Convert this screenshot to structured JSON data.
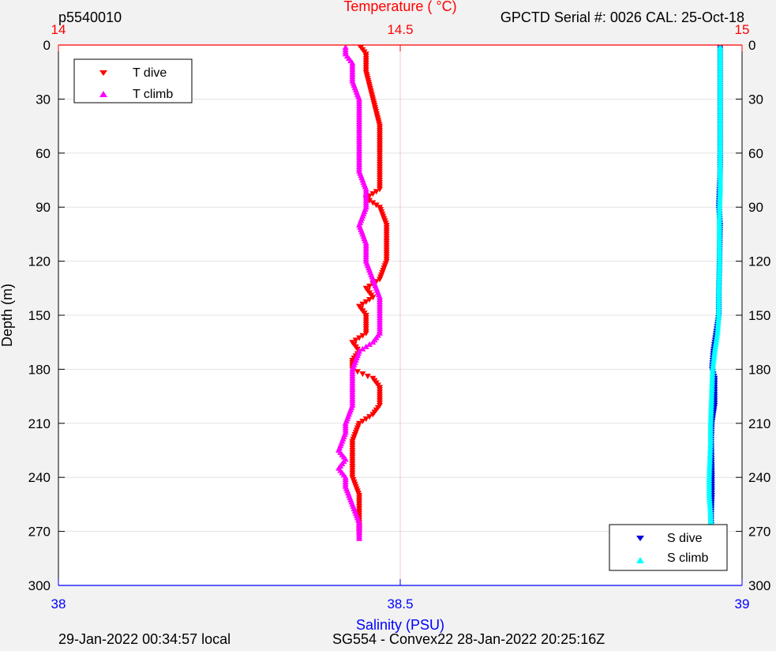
{
  "header": {
    "profile_id": "p5540010",
    "instrument_cal": "GPCTD Serial #: 0026 CAL: 25-Oct-18"
  },
  "footer": {
    "local_time": "29-Jan-2022 00:34:57 local",
    "mission": "SG554 - Convex22 28-Jan-2022 20:25:16Z"
  },
  "colors": {
    "background": "#f2f2f2",
    "plot_bg": "#ffffff",
    "temperature_axis": "#ff0000",
    "salinity_axis": "#0000ff",
    "t_dive": "#ff0000",
    "t_climb": "#ff00ff",
    "s_dive": "#0000dd",
    "s_climb": "#00ffff"
  },
  "chart_data": {
    "type": "scatter",
    "y_axis": {
      "label": "Depth (m)",
      "range": [
        0,
        300
      ],
      "reversed": true,
      "ticks": [
        "0",
        "30",
        "60",
        "90",
        "120",
        "150",
        "180",
        "210",
        "240",
        "270",
        "300"
      ]
    },
    "top_axis": {
      "label": "Temperature (    °C)",
      "range": [
        14,
        15
      ],
      "ticks": [
        "14",
        "14.5",
        "15"
      ]
    },
    "bottom_axis": {
      "label": "Salinity (PSU)",
      "range": [
        38,
        39
      ],
      "ticks": [
        "38",
        "38.5",
        "39"
      ]
    },
    "grid": "horizontal-and-center-vertical",
    "legend_temperature": {
      "placement": "top-left",
      "entries": [
        "T dive",
        "T climb"
      ]
    },
    "legend_salinity": {
      "placement": "bottom-right",
      "entries": [
        "S dive",
        "S climb"
      ]
    },
    "series": [
      {
        "name": "T dive",
        "axis": "temperature",
        "marker": "triangle-down",
        "points": [
          [
            0,
            14.44
          ],
          [
            5,
            14.45
          ],
          [
            15,
            14.45
          ],
          [
            30,
            14.46
          ],
          [
            45,
            14.47
          ],
          [
            60,
            14.47
          ],
          [
            70,
            14.47
          ],
          [
            80,
            14.47
          ],
          [
            85,
            14.45
          ],
          [
            90,
            14.47
          ],
          [
            100,
            14.48
          ],
          [
            110,
            14.48
          ],
          [
            120,
            14.48
          ],
          [
            130,
            14.47
          ],
          [
            135,
            14.45
          ],
          [
            140,
            14.46
          ],
          [
            145,
            14.44
          ],
          [
            150,
            14.45
          ],
          [
            160,
            14.45
          ],
          [
            165,
            14.43
          ],
          [
            170,
            14.44
          ],
          [
            175,
            14.43
          ],
          [
            180,
            14.43
          ],
          [
            185,
            14.46
          ],
          [
            190,
            14.47
          ],
          [
            200,
            14.47
          ],
          [
            205,
            14.46
          ],
          [
            210,
            14.44
          ],
          [
            220,
            14.43
          ],
          [
            230,
            14.43
          ],
          [
            240,
            14.43
          ],
          [
            250,
            14.44
          ],
          [
            260,
            14.44
          ],
          [
            270,
            14.44
          ],
          [
            274,
            14.44
          ]
        ]
      },
      {
        "name": "T climb",
        "axis": "temperature",
        "marker": "triangle-up",
        "points": [
          [
            274,
            14.44
          ],
          [
            265,
            14.44
          ],
          [
            255,
            14.43
          ],
          [
            245,
            14.42
          ],
          [
            240,
            14.42
          ],
          [
            235,
            14.41
          ],
          [
            230,
            14.42
          ],
          [
            225,
            14.41
          ],
          [
            215,
            14.42
          ],
          [
            210,
            14.42
          ],
          [
            200,
            14.43
          ],
          [
            190,
            14.43
          ],
          [
            180,
            14.43
          ],
          [
            170,
            14.44
          ],
          [
            165,
            14.46
          ],
          [
            160,
            14.47
          ],
          [
            150,
            14.47
          ],
          [
            140,
            14.47
          ],
          [
            130,
            14.46
          ],
          [
            120,
            14.45
          ],
          [
            110,
            14.45
          ],
          [
            100,
            14.44
          ],
          [
            90,
            14.45
          ],
          [
            80,
            14.45
          ],
          [
            70,
            14.44
          ],
          [
            60,
            14.44
          ],
          [
            50,
            14.44
          ],
          [
            40,
            14.44
          ],
          [
            30,
            14.44
          ],
          [
            20,
            14.43
          ],
          [
            10,
            14.43
          ],
          [
            5,
            14.42
          ],
          [
            0,
            14.42
          ]
        ]
      },
      {
        "name": "S dive",
        "axis": "salinity",
        "marker": "triangle-down",
        "points": [
          [
            0,
            38.968
          ],
          [
            20,
            38.968
          ],
          [
            40,
            38.968
          ],
          [
            60,
            38.968
          ],
          [
            70,
            38.968
          ],
          [
            80,
            38.967
          ],
          [
            90,
            38.966
          ],
          [
            100,
            38.968
          ],
          [
            120,
            38.967
          ],
          [
            140,
            38.966
          ],
          [
            150,
            38.966
          ],
          [
            160,
            38.962
          ],
          [
            170,
            38.958
          ],
          [
            180,
            38.956
          ],
          [
            185,
            38.96
          ],
          [
            190,
            38.96
          ],
          [
            200,
            38.96
          ],
          [
            210,
            38.956
          ],
          [
            220,
            38.955
          ],
          [
            240,
            38.956
          ],
          [
            250,
            38.956
          ],
          [
            260,
            38.955
          ],
          [
            270,
            38.955
          ],
          [
            274,
            38.955
          ]
        ]
      },
      {
        "name": "S climb",
        "axis": "salinity",
        "marker": "triangle-up",
        "points": [
          [
            274,
            38.955
          ],
          [
            260,
            38.954
          ],
          [
            250,
            38.952
          ],
          [
            240,
            38.952
          ],
          [
            230,
            38.953
          ],
          [
            220,
            38.954
          ],
          [
            210,
            38.954
          ],
          [
            200,
            38.955
          ],
          [
            190,
            38.956
          ],
          [
            180,
            38.957
          ],
          [
            170,
            38.96
          ],
          [
            160,
            38.964
          ],
          [
            150,
            38.966
          ],
          [
            140,
            38.966
          ],
          [
            120,
            38.967
          ],
          [
            100,
            38.967
          ],
          [
            90,
            38.967
          ],
          [
            80,
            38.968
          ],
          [
            60,
            38.968
          ],
          [
            40,
            38.968
          ],
          [
            20,
            38.968
          ],
          [
            0,
            38.968
          ]
        ]
      }
    ]
  }
}
